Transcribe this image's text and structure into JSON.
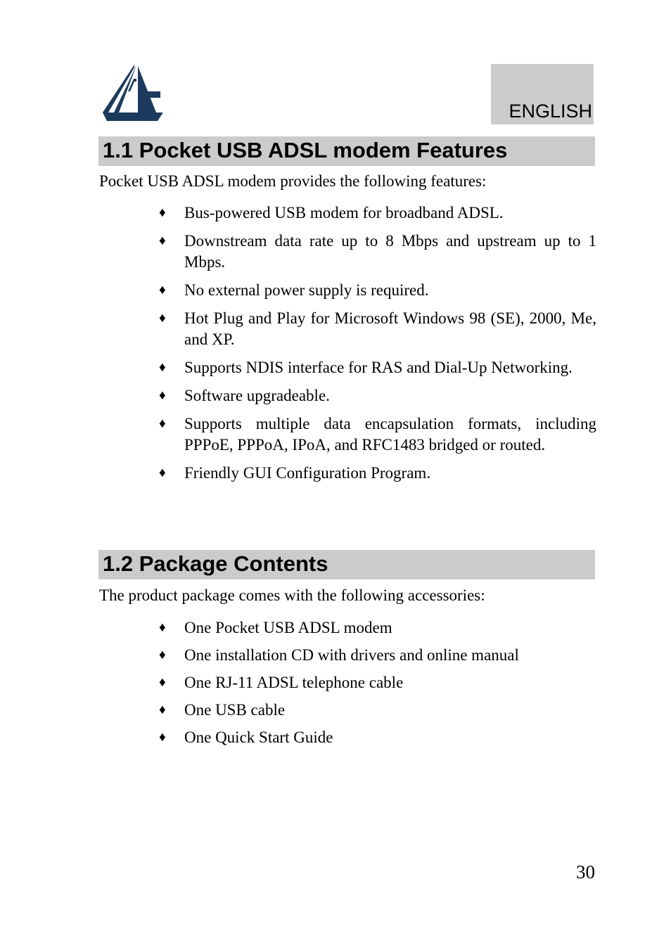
{
  "header": {
    "logo_name": "atlantis-land-logo",
    "logo_color": "#1c3a5e",
    "language_label": "ENGLISH",
    "language_box_color": "#cbcbcb"
  },
  "sections": [
    {
      "id": "features",
      "heading": "1.1 Pocket USB ADSL modem Features",
      "intro": "Pocket USB ADSL modem provides the following features:",
      "bullets": [
        "Bus-powered USB modem for broadband ADSL.",
        "Downstream data rate up to 8 Mbps and upstream up to 1 Mbps.",
        "No external power supply is required.",
        "Hot Plug and Play for Microsoft Windows 98 (SE), 2000, Me, and XP.",
        "Supports NDIS interface for RAS and Dial-Up Networking.",
        "Software upgradeable.",
        "Supports multiple data encapsulation formats, including PPPoE, PPPoA, IPoA, and RFC1483 bridged or routed.",
        "Friendly GUI Configuration Program."
      ]
    },
    {
      "id": "package",
      "heading": "1.2 Package Contents",
      "intro": "The product package comes with the following accessories:",
      "bullets": [
        "One Pocket USB ADSL modem",
        "One installation CD with drivers and online manual",
        "One RJ-11 ADSL telephone cable",
        "One USB cable",
        "One Quick Start Guide"
      ]
    }
  ],
  "footer": {
    "page_number": "30"
  },
  "bullet_glyph": "♦"
}
